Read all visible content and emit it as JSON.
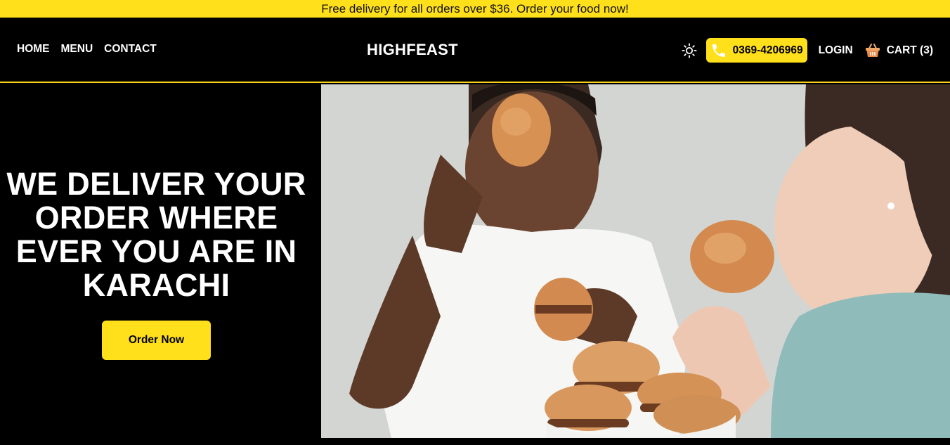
{
  "promo": {
    "text": "Free delivery for all orders over $36. Order your food now!"
  },
  "nav": {
    "links": [
      "HOME",
      "MENU",
      "CONTACT"
    ],
    "brand": "HIGHFEAST",
    "phone": "0369-4206969",
    "login": "LOGIN",
    "cart": "CART (3)"
  },
  "hero": {
    "title": "WE DELIVER YOUR ORDER WHERE EVER YOU ARE IN KARACHI",
    "cta": "Order Now"
  },
  "colors": {
    "accent": "#ffe01b",
    "background": "#000000",
    "text": "#ffffff"
  },
  "icons": {
    "theme": "sun-icon",
    "phone": "phone-icon",
    "cart": "basket-icon"
  }
}
